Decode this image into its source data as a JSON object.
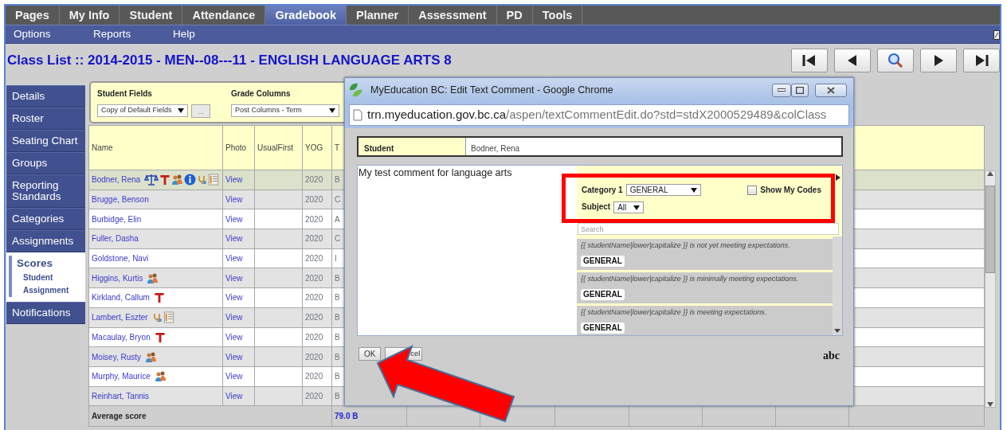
{
  "menu": [
    {
      "label": "Pages",
      "selected": false
    },
    {
      "label": "My Info",
      "selected": false
    },
    {
      "label": "Student",
      "selected": false
    },
    {
      "label": "Attendance",
      "selected": false
    },
    {
      "label": "Gradebook",
      "selected": true
    },
    {
      "label": "Planner",
      "selected": false
    },
    {
      "label": "Assessment",
      "selected": false
    },
    {
      "label": "PD",
      "selected": false
    },
    {
      "label": "Tools",
      "selected": false
    }
  ],
  "submenu": [
    "Options",
    "Reports",
    "Help"
  ],
  "page_title": "Class List :: 2014-2015 - MEN--08---11 - ENGLISH LANGUAGE ARTS 8",
  "nav_buttons": [
    {
      "kind": "first"
    },
    {
      "kind": "previous"
    },
    {
      "kind": "search"
    },
    {
      "kind": "next"
    },
    {
      "kind": "last"
    }
  ],
  "sidebar": {
    "items": [
      {
        "label": "Details",
        "selected": false
      },
      {
        "label": "Roster",
        "selected": false
      },
      {
        "label": "Seating Chart",
        "selected": false
      },
      {
        "label": "Groups",
        "selected": false
      },
      {
        "label": "Reporting Standards",
        "selected": false
      },
      {
        "label": "Categories",
        "selected": false
      },
      {
        "label": "Assignments",
        "selected": false
      },
      {
        "label": "Scores",
        "selected": true,
        "children": [
          {
            "label": "Student"
          },
          {
            "label": "Assignment"
          }
        ]
      },
      {
        "label": "Notifications",
        "selected": false
      }
    ]
  },
  "filters": [
    {
      "label": "Student Fields",
      "value": "Copy of Default Fields",
      "button": "..."
    },
    {
      "label": "Grade Columns",
      "value": "Post Columns - Term"
    }
  ],
  "table": {
    "columns": [
      "Name",
      "Photo",
      "UsualFirst",
      "YOG",
      "T"
    ],
    "rows": [
      {
        "name": "Bodner, Rena",
        "icons": [
          {
            "kind": "scales"
          },
          {
            "kind": "staff"
          },
          {
            "kind": "people"
          },
          {
            "kind": "info"
          },
          {
            "kind": "stethoscope"
          },
          {
            "kind": "notepad"
          }
        ],
        "photo": "View",
        "yog": "2020",
        "column_5": "B",
        "selected": true
      },
      {
        "name": "Brugge, Benson",
        "icons": [],
        "photo": "View",
        "yog": "2020",
        "column_5": "C",
        "selected": false
      },
      {
        "name": "Burbidge, Elin",
        "icons": [],
        "photo": "View",
        "yog": "2020",
        "column_5": "A",
        "selected": false
      },
      {
        "name": "Fuller, Dasha",
        "icons": [],
        "photo": "View",
        "yog": "2020",
        "column_5": "C",
        "selected": false
      },
      {
        "name": "Goldstone, Navi",
        "icons": [],
        "photo": "View",
        "yog": "2020",
        "column_5": "I",
        "selected": false
      },
      {
        "name": "Higgins, Kurtis",
        "icons": [
          {
            "kind": "people"
          }
        ],
        "photo": "View",
        "yog": "2020",
        "column_5": "B",
        "selected": false
      },
      {
        "name": "Kirkland, Callum",
        "icons": [
          {
            "kind": "staff"
          }
        ],
        "photo": "View",
        "yog": "2020",
        "column_5": "B",
        "selected": false
      },
      {
        "name": "Lambert, Eszter",
        "icons": [
          {
            "kind": "stethoscope"
          },
          {
            "kind": "notepad"
          }
        ],
        "photo": "View",
        "yog": "2020",
        "column_5": "B",
        "selected": false
      },
      {
        "name": "Macaulay, Bryon",
        "icons": [
          {
            "kind": "staff"
          }
        ],
        "photo": "View",
        "yog": "2020",
        "column_5": "B",
        "selected": false
      },
      {
        "name": "Moisey, Rusty",
        "icons": [
          {
            "kind": "people"
          }
        ],
        "photo": "View",
        "yog": "2020",
        "column_5": "B",
        "selected": false
      },
      {
        "name": "Murphy, Maurice",
        "icons": [
          {
            "kind": "people"
          }
        ],
        "photo": "View",
        "yog": "2020",
        "column_5": "B",
        "selected": false
      },
      {
        "name": "Reinhart, Tannis",
        "icons": [],
        "photo": "View",
        "yog": "2020",
        "column_5": "B",
        "selected": false
      }
    ],
    "footer": {
      "label": "Average score",
      "value": "79.0 B"
    }
  },
  "popup": {
    "title": "MyEducation BC: Edit Text Comment - Google Chrome",
    "url_host": "trn.myeducation.gov.bc.ca",
    "url_path": "/aspen/textCommentEdit.do?std=stdX2000529489&colClass",
    "student_label": "Student",
    "student_value": "Bodner, Rena",
    "comment": "My test comment for language arts",
    "category_label": "Category 1",
    "category_value": "GENERAL",
    "show_my_codes": {
      "label": "Show My Codes",
      "checked": false
    },
    "subject_label": "Subject",
    "subject_value": "All",
    "search_placeholder": "Search",
    "suggestions": [
      {
        "text": "{{ studentName|lower|capitalize }} is not yet meeting expectations.",
        "tag": "GENERAL"
      },
      {
        "text": "{{ studentName|lower|capitalize }} is minimally meeting expectations.",
        "tag": "GENERAL"
      },
      {
        "text": "{{ studentName|lower|capitalize }} is meeting expectations.",
        "tag": "GENERAL"
      }
    ],
    "ok": "OK",
    "cancel": "cel",
    "spellcheck": "abc"
  }
}
